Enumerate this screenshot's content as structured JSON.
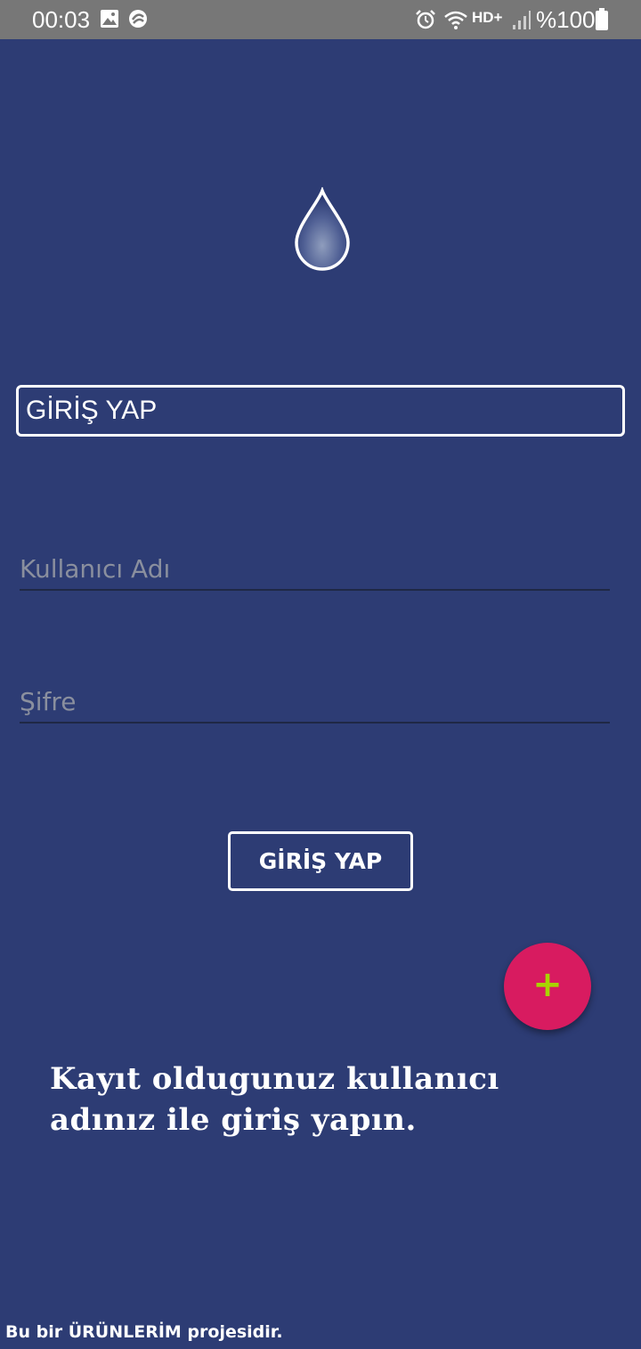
{
  "status_bar": {
    "time": "00:03",
    "network_label": "HD+",
    "battery_text": "%100",
    "icons": [
      "image-icon",
      "sync-app-icon",
      "alarm-icon",
      "wifi-icon",
      "signal-icon",
      "battery-icon"
    ]
  },
  "logo": {
    "icon": "water-drop-icon"
  },
  "header": {
    "title": "GİRİŞ YAP"
  },
  "form": {
    "username_placeholder": "Kullanıcı Adı",
    "username_value": "",
    "password_placeholder": "Şifre",
    "password_value": "",
    "login_button_label": "GİRİŞ YAP"
  },
  "fab": {
    "icon": "plus-icon",
    "symbol": "+"
  },
  "info": {
    "line1": "Kayıt oldugunuz kullanıcı",
    "line2": "adınız ile giriş yapın."
  },
  "footer": {
    "text": "Bu bir ÜRÜNLERİM projesidir."
  },
  "colors": {
    "background": "#2d3c74",
    "status_bar": "#777777",
    "fab": "#d81b60",
    "fab_icon": "#a8d400",
    "placeholder": "#8a8f9e"
  }
}
